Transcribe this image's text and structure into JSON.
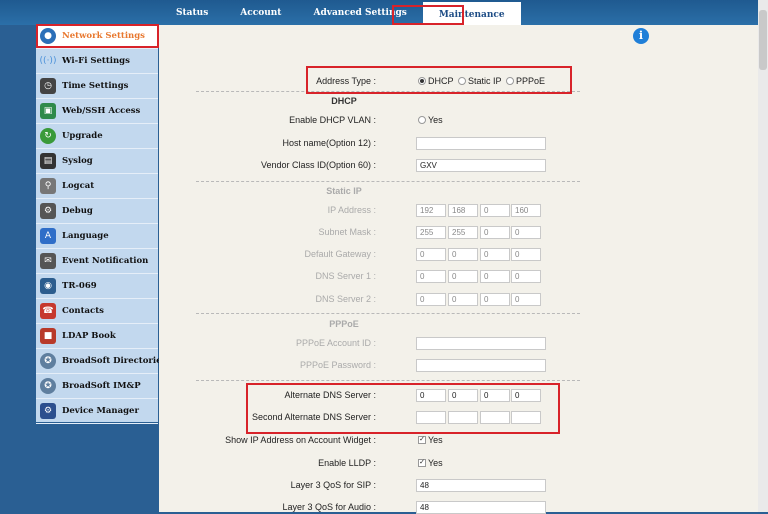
{
  "tabs": [
    "Status",
    "Account",
    "Advanced Settings",
    "Maintenance"
  ],
  "sidebar": [
    {
      "label": "Network Settings",
      "icon": "network-icon",
      "color": "#2b6fb8"
    },
    {
      "label": "Wi-Fi Settings",
      "icon": "wifi-icon",
      "color": "#4a90d9"
    },
    {
      "label": "Time Settings",
      "icon": "time-icon",
      "color": "#444"
    },
    {
      "label": "Web/SSH Access",
      "icon": "web-ssh-icon",
      "color": "#2f8a4a"
    },
    {
      "label": "Upgrade",
      "icon": "upgrade-icon",
      "color": "#3a9a3a"
    },
    {
      "label": "Syslog",
      "icon": "syslog-icon",
      "color": "#333"
    },
    {
      "label": "Logcat",
      "icon": "logcat-icon",
      "color": "#666"
    },
    {
      "label": "Debug",
      "icon": "debug-icon",
      "color": "#555"
    },
    {
      "label": "Language",
      "icon": "language-icon",
      "color": "#2f6ec8"
    },
    {
      "label": "Event Notification",
      "icon": "event-notification-icon",
      "color": "#555"
    },
    {
      "label": "TR-069",
      "icon": "tr069-icon",
      "color": "#2c5d8e"
    },
    {
      "label": "Contacts",
      "icon": "contacts-icon",
      "color": "#c6392e"
    },
    {
      "label": "LDAP Book",
      "icon": "ldap-book-icon",
      "color": "#b83a2a"
    },
    {
      "label": "BroadSoft Directories",
      "icon": "broadsoft-directories-icon",
      "color": "#5f7f9f"
    },
    {
      "label": "BroadSoft IM&P",
      "icon": "broadsoft-imp-icon",
      "color": "#5f7f9f"
    },
    {
      "label": "Device Manager",
      "icon": "device-manager-icon",
      "color": "#2c4f8e"
    }
  ],
  "form": {
    "address_type_label": "Address Type :",
    "address_type_options": [
      "DHCP",
      "Static IP",
      "PPPoE"
    ],
    "address_type_selected": "DHCP",
    "dhcp_title": "DHCP",
    "enable_dhcp_vlan_label": "Enable DHCP VLAN :",
    "enable_dhcp_vlan_option": "Yes",
    "hostname_label": "Host name(Option 12) :",
    "hostname_value": "",
    "vendor_class_label": "Vendor Class ID(Option 60) :",
    "vendor_class_value": "GXV",
    "static_title": "Static IP",
    "ip_address_label": "IP Address :",
    "ip_address": [
      "192",
      "168",
      "0",
      "160"
    ],
    "subnet_mask_label": "Subnet Mask :",
    "subnet_mask": [
      "255",
      "255",
      "0",
      "0"
    ],
    "gateway_label": "Default Gateway :",
    "gateway": [
      "0",
      "0",
      "0",
      "0"
    ],
    "dns1_label": "DNS Server 1 :",
    "dns1": [
      "0",
      "0",
      "0",
      "0"
    ],
    "dns2_label": "DNS Server 2 :",
    "dns2": [
      "0",
      "0",
      "0",
      "0"
    ],
    "pppoe_title": "PPPoE",
    "pppoe_account_label": "PPPoE Account ID :",
    "pppoe_account_value": "",
    "pppoe_password_label": "PPPoE Password :",
    "pppoe_password_value": "",
    "alt_dns_label": "Alternate DNS Server :",
    "alt_dns": [
      "0",
      "0",
      "0",
      "0"
    ],
    "second_alt_dns_label": "Second Alternate DNS Server :",
    "second_alt_dns": [
      "",
      "",
      "",
      ""
    ],
    "show_ip_label": "Show IP Address on Account Widget :",
    "show_ip_option": "Yes",
    "enable_lldp_label": "Enable LLDP :",
    "enable_lldp_option": "Yes",
    "qos_sip_label": "Layer 3 QoS for SIP :",
    "qos_sip_value": "48",
    "qos_audio_label": "Layer 3 QoS for Audio :",
    "qos_audio_value": "48"
  }
}
